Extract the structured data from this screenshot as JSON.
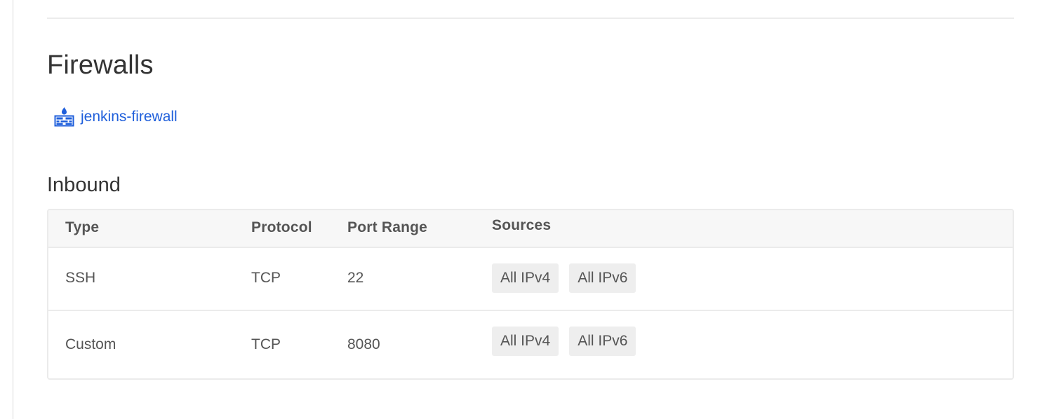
{
  "section": {
    "title": "Firewalls"
  },
  "firewall": {
    "name": "jenkins-firewall",
    "icon": "firewall-icon",
    "color": "#1f5fdb"
  },
  "inbound": {
    "title": "Inbound",
    "columns": [
      "Type",
      "Protocol",
      "Port Range",
      "Sources"
    ],
    "rules": [
      {
        "type": "SSH",
        "protocol": "TCP",
        "port_range": "22",
        "sources": [
          "All IPv4",
          "All IPv6"
        ]
      },
      {
        "type": "Custom",
        "protocol": "TCP",
        "port_range": "8080",
        "sources": [
          "All IPv4",
          "All IPv6"
        ]
      }
    ]
  }
}
